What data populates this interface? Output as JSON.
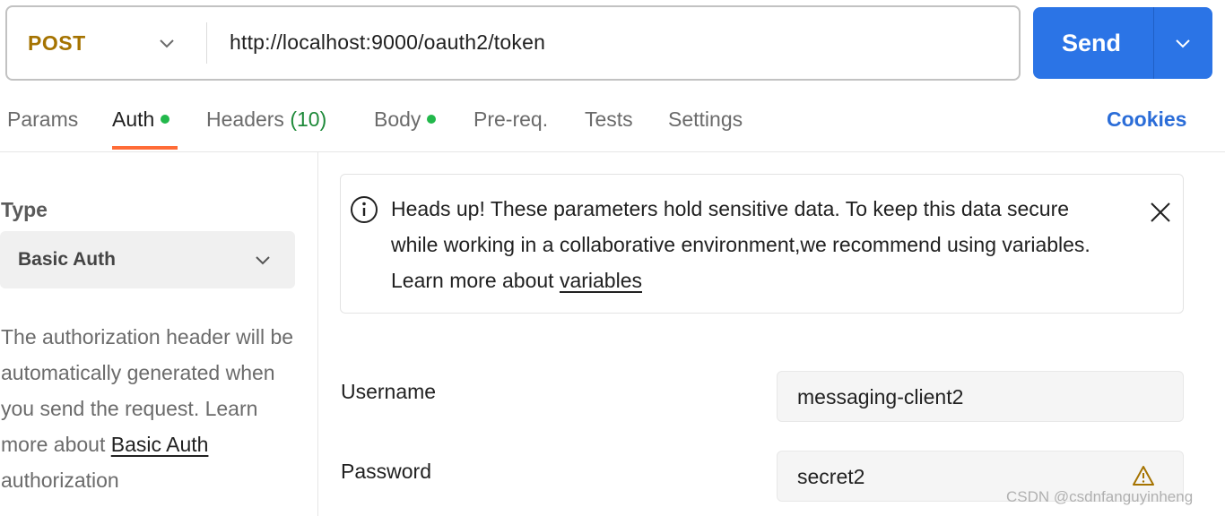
{
  "request": {
    "method": "POST",
    "url": "http://localhost:9000/oauth2/token",
    "send_label": "Send"
  },
  "tabs": {
    "params": "Params",
    "auth": "Auth",
    "headers": "Headers",
    "headers_count": "(10)",
    "body": "Body",
    "prereq": "Pre-req.",
    "tests": "Tests",
    "settings": "Settings",
    "cookies": "Cookies"
  },
  "auth": {
    "type_label": "Type",
    "type_value": "Basic Auth",
    "description": "The authorization header will be automatically generated when you send the request. Learn more about ",
    "description_link": "Basic Auth",
    "description_tail": "authorization"
  },
  "alert": {
    "text": "Heads up! These parameters hold sensitive data. To keep this data secure while working in a collaborative environment,we recommend using variables. Learn more about ",
    "link": "variables"
  },
  "fields": {
    "username_label": "Username",
    "username_value": "messaging-client2",
    "password_label": "Password",
    "password_value": "secret2"
  },
  "watermark": "CSDN @csdnfanguyinheng",
  "colors": {
    "method": "#a57300",
    "send": "#2b74e6",
    "active_tab_underline": "#ff6c37",
    "status_dot": "#22b84b",
    "cookies_link": "#2b6dd8"
  },
  "icons": [
    "chevron-down-icon",
    "info-icon",
    "close-icon",
    "warning-icon"
  ]
}
